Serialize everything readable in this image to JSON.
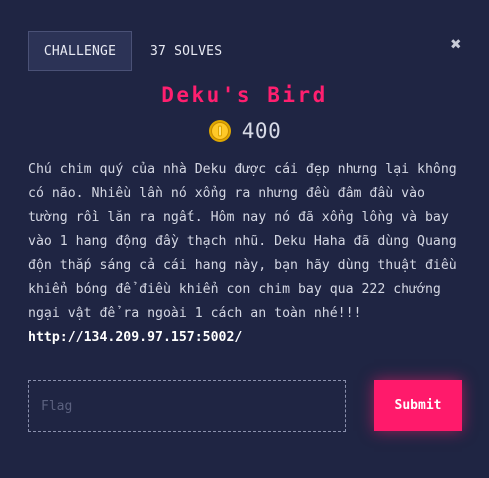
{
  "tabs": {
    "challenge_label": "CHALLENGE",
    "solves_label": "37 SOLVES"
  },
  "close_icon": "close-icon",
  "challenge": {
    "title": "Deku's Bird",
    "points": "400",
    "coin_icon": "coin-icon",
    "description": "Chú chim quý của nhà Deku được cái đẹp nhưng lại không có não. Nhiều lần nó xổng ra nhưng đều đâm đầu vào tường rồi lăn ra ngất. Hôm nay nó đã xổng lồng và bay vào 1 hang động đầy thạch nhũ. Deku Haha đã dùng Quang độn thắp sáng cả cái hang này, bạn hãy dùng thuật điều khiển bóng để điều khiển con chim bay qua 222 chướng ngại vật để ra ngoài 1 cách an toàn nhé!!!",
    "link": "http://134.209.97.157:5002/"
  },
  "form": {
    "flag_placeholder": "Flag",
    "flag_value": "",
    "submit_label": "Submit"
  },
  "colors": {
    "background": "#1f2543",
    "accent": "#ff1a6b",
    "title": "#ff1f6f",
    "coin": "#f2b705"
  }
}
